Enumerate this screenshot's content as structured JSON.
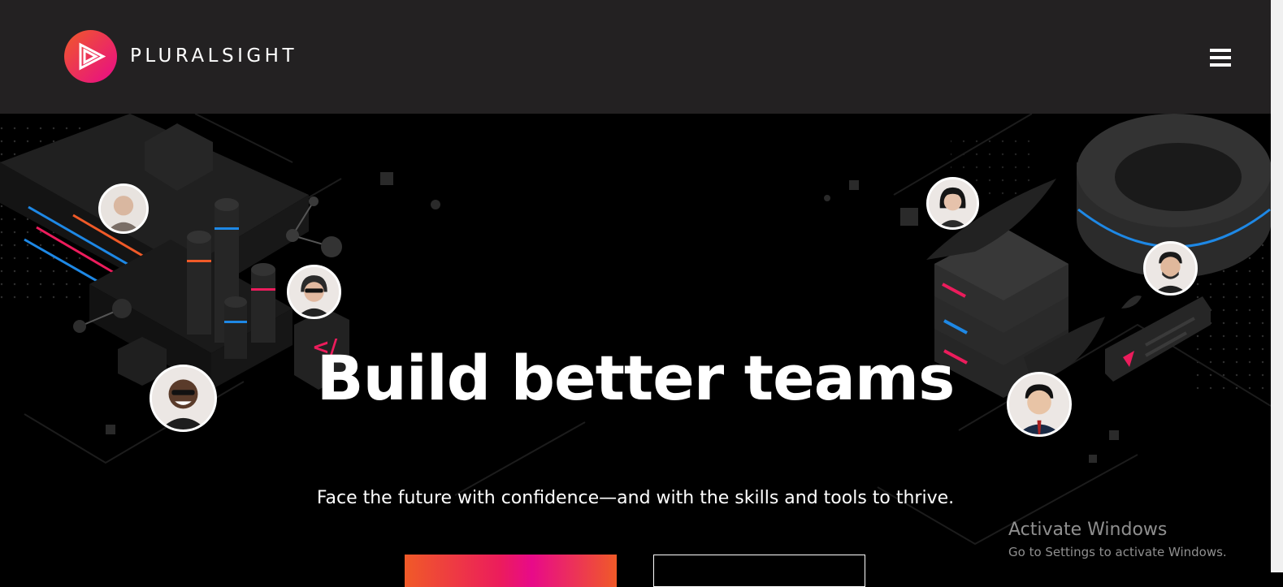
{
  "brand": {
    "name": "PLURALSIGHT",
    "accent": "#e80a89",
    "accent_alt": "#f05a28"
  },
  "nav": {
    "menu_icon": "hamburger-icon"
  },
  "hero": {
    "headline": "Build better teams",
    "subheadline": "Face the future with confidence—and with the skills and tools to thrive.",
    "cta_primary_label": "",
    "cta_secondary_label": ""
  },
  "watermark": {
    "title": "Activate Windows",
    "subtitle": "Go to Settings to activate Windows."
  }
}
